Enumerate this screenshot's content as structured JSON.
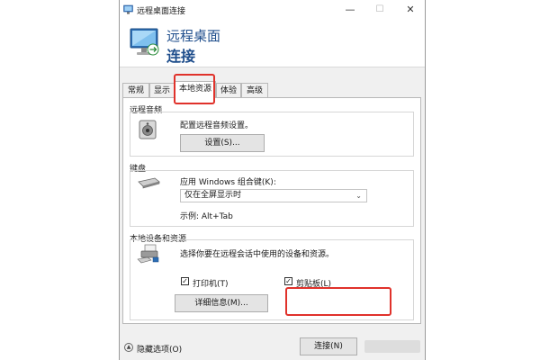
{
  "window": {
    "title": "远程桌面连接",
    "minimize_glyph": "—",
    "maximize_glyph": "☐",
    "close_glyph": "✕"
  },
  "header": {
    "line1": "远程桌面",
    "line2": "连接",
    "icon": "remote-desktop-monitor-icon"
  },
  "tabs": [
    {
      "label": "常规"
    },
    {
      "label": "显示"
    },
    {
      "label": "本地资源",
      "active": true
    },
    {
      "label": "体验"
    },
    {
      "label": "高级"
    }
  ],
  "audio": {
    "group_title": "远程音频",
    "description": "配置远程音频设置。",
    "button_label": "设置(S)...",
    "icon": "speaker-icon"
  },
  "keyboard": {
    "group_title": "键盘",
    "apply_label": "应用 Windows 组合键(K):",
    "selected_option": "仅在全屏显示时",
    "example_text": "示例: Alt+Tab",
    "icon": "keyboard-icon"
  },
  "devices": {
    "group_title": "本地设备和资源",
    "description": "选择你要在远程会话中使用的设备和资源。",
    "printer_label": "打印机(T)",
    "printer_checked": true,
    "clipboard_label": "剪贴板(L)",
    "clipboard_checked": true,
    "details_button_label": "详细信息(M)...",
    "icon": "devices-icon"
  },
  "footer": {
    "hide_options_label": "隐藏选项(O)",
    "connect_button_label": "连接(N)"
  },
  "highlight_color": "#e0322b"
}
